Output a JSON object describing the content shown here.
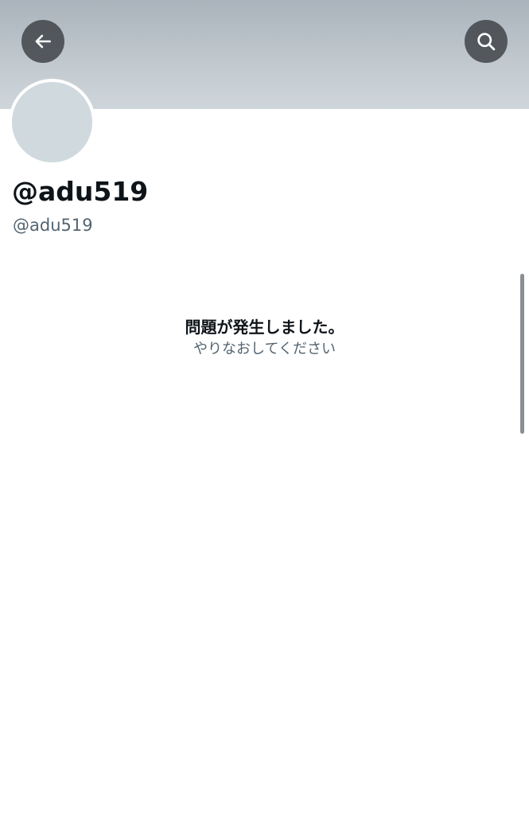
{
  "profile": {
    "display_name": "@adu519",
    "handle": "@adu519"
  },
  "header": {
    "back_icon": "arrow-left-icon",
    "search_icon": "search-icon"
  },
  "error": {
    "title": "問題が発生しました。",
    "subtitle": "やりなおしてください"
  },
  "colors": {
    "banner": "#c0c8ce",
    "avatar_placeholder": "#cfd9de",
    "primary_text": "#0f1419",
    "secondary_text": "#536471"
  }
}
